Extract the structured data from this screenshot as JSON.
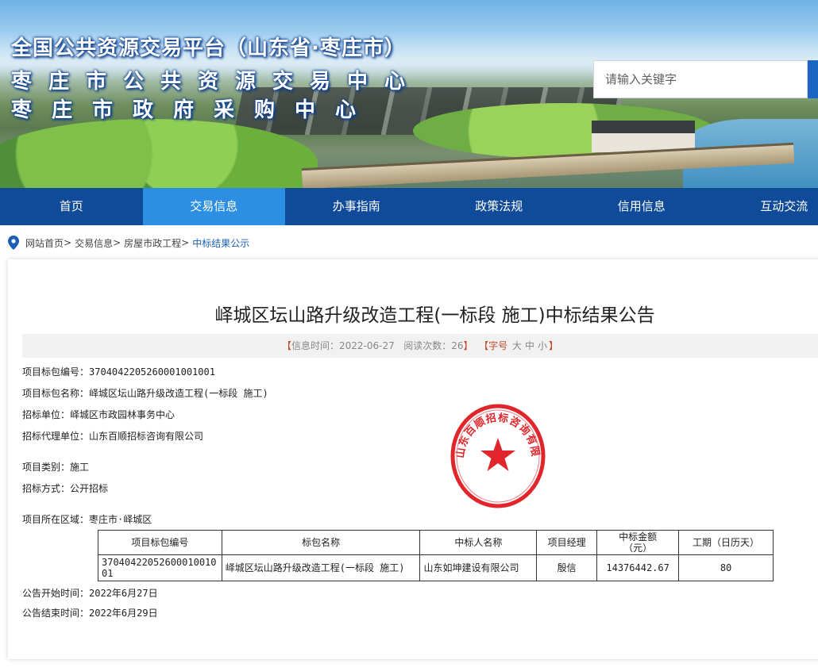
{
  "header": {
    "title_line_1": "全国公共资源交易平台（山东省·枣庄市）",
    "title_line_2": "枣庄市公共资源交易中心",
    "title_line_3": "枣庄市政府采购中心",
    "search_placeholder": "请输入关键字"
  },
  "nav": {
    "items": [
      {
        "label": "首页"
      },
      {
        "label": "交易信息"
      },
      {
        "label": "办事指南"
      },
      {
        "label": "政策法规"
      },
      {
        "label": "信用信息"
      },
      {
        "label": "互动交流"
      }
    ],
    "active_index": 1
  },
  "breadcrumb": {
    "items": [
      "网站首页",
      "交易信息",
      "房屋市政工程",
      "中标结果公示"
    ],
    "separator": ">"
  },
  "article": {
    "title": "峄城区坛山路升级改造工程(一标段 施工)中标结果公告",
    "meta_open": "【",
    "meta_info_time_label": "信息时间：",
    "meta_info_time": "2022-06-27",
    "meta_views_label": "阅读次数：",
    "meta_views": "26",
    "meta_close": "】",
    "font_size_label_open": "【字号",
    "font_size_large": "大",
    "font_size_medium": "中",
    "font_size_small": "小",
    "font_size_label_close": "】"
  },
  "fields": [
    {
      "label": "项目标包编号：",
      "value": "370404220526000100​1001"
    },
    {
      "label": "项目标包名称：",
      "value": "峄城区坛山路升级改造工程(一标段 施工)"
    },
    {
      "label": "招标单位：",
      "value": "峄城区市政园林事务中心"
    },
    {
      "label": "招标代理单位：",
      "value": "山东百顺招标咨询有限公司"
    },
    {
      "label": "项目类别：",
      "value": "施工"
    },
    {
      "label": "招标方式：",
      "value": "公开招标"
    },
    {
      "label": "项目所在区域：",
      "value": "枣庄市·峄城区"
    }
  ],
  "seal": {
    "text": "山东百顺招标咨询有限公司",
    "color": "#e0262b"
  },
  "table": {
    "headers": [
      "项目标包编号",
      "标包名称",
      "中标人名称",
      "项目经理",
      "中标金额\n（元）",
      "工期（日历天）"
    ],
    "rows": [
      [
        "3704042205260001001001",
        "峄城区坛山路升级改造工程(一标段 施工)",
        "山东如坤建设有限公司",
        "殷信",
        "14376442.67",
        "80"
      ]
    ]
  },
  "notice": {
    "start_label": "公告开始时间：",
    "start_value": "2022年6月27日",
    "end_label": "公告结束时间：",
    "end_value": "2022年6月29日"
  },
  "colors": {
    "nav_bg": "#104b99",
    "nav_active": "#2c8fe4",
    "breadcrumb_current": "#1a5fb4",
    "seal_red": "#e0262b"
  }
}
